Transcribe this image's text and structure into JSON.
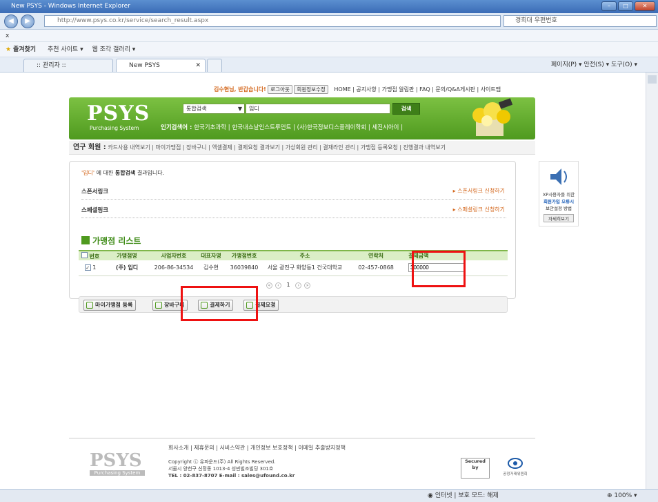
{
  "browser": {
    "window_title": "New PSYS - Windows Internet Explorer",
    "address": "http://www.psys.co.kr/service/search_result.aspx",
    "search_placeholder": "경희대 우편번호",
    "menu_x": "x",
    "favorites_label": "즐겨찾기",
    "fav_items": [
      "추천 사이트 ▾",
      "웹 조각 갤러리 ▾"
    ],
    "tabs": [
      ":: 관리자 ::",
      "New PSYS"
    ],
    "toolbar_right": "페이지(P) ▾  안전(S) ▾  도구(O) ▾"
  },
  "header": {
    "greeting": "김수현님, 반갑습니다!",
    "logout": "로그아웃",
    "profile": "회원정보수정",
    "nav": "HOME | 공지사항 | 가맹점 알림판 | FAQ | 문의/Q&A게시판 | 사이트맵"
  },
  "banner": {
    "logo": "PSYS",
    "logo_sub": "Purchasing System",
    "search_scope": "통합검색",
    "query": "입디",
    "search_button": "검색",
    "popular_label": "인기검색어 :",
    "popular_terms": "한국기초과학 | 한국내쇼날인스트루먼트 | (사)한국정보디스플레이학회 | 세진시아이 |"
  },
  "member_bar": {
    "label": "연구 회원 :",
    "links": "카드사용 내역보기 | 마이가맹점 | 장바구니 | 엑셀결제 | 결제요청 결과보기 | 가상회원 관리 | 결재라인 관리 | 가맹점 등록요청 | 진행결과 내역보기"
  },
  "results": {
    "msg_keyword": "'입디'",
    "msg_mid": " 에 대한 ",
    "msg_bold": "통합검색",
    "msg_end": " 결과입니다.",
    "sponsor_label": "스폰서링크",
    "sponsor_apply": "▸ 스폰서링크 신청하기",
    "special_label": "스페셜링크",
    "special_apply": "▸ 스페셜링크 신청하기",
    "list_title": "가맹점 리스트"
  },
  "table": {
    "headers": [
      "번호",
      "가맹점명",
      "사업자번호",
      "대표자명",
      "가맹점번호",
      "주소",
      "연락처",
      "결제금액"
    ],
    "row": {
      "checked": "✓",
      "no": "1",
      "name": "(주) 입디",
      "biz_no": "206-86-34534",
      "owner": "김수현",
      "store_no": "36039840",
      "address": "서울 광진구 화양동1 건국대학교",
      "phone": "02-457-0868",
      "amount": "300000"
    }
  },
  "pager": {
    "current": "1"
  },
  "actions": {
    "my_store": "마이가맹점 등록",
    "cart": "장바구니",
    "pay": "결제하기",
    "request": "결제요청"
  },
  "side_ad": {
    "line1": "XP사용자를 위한",
    "line2": "회원가입 오류시",
    "line3": "보안설정 방법",
    "button": "자세히보기"
  },
  "footer": {
    "links": "회사소개 | 제휴문의 | 서비스약관 | 개인정보 보호정책 | 이메일 추출방지정책",
    "logo": "PSYS",
    "logo_sub": "Purchasing System",
    "copyright": "Copyright ⓒ 유파운드(주) All Rights Reserved.",
    "address": "서울시 양천구 신정동 1013-4 성빈빌조빌딩 301호",
    "contact": "TEL : 02-837-8707   E-mail : sales@ufound.co.kr",
    "seal1": "Secured by",
    "seal2": "공정거래위원회"
  },
  "status": {
    "zone": "인터넷 | 보호 모드: 해제",
    "zoom": "100%"
  }
}
